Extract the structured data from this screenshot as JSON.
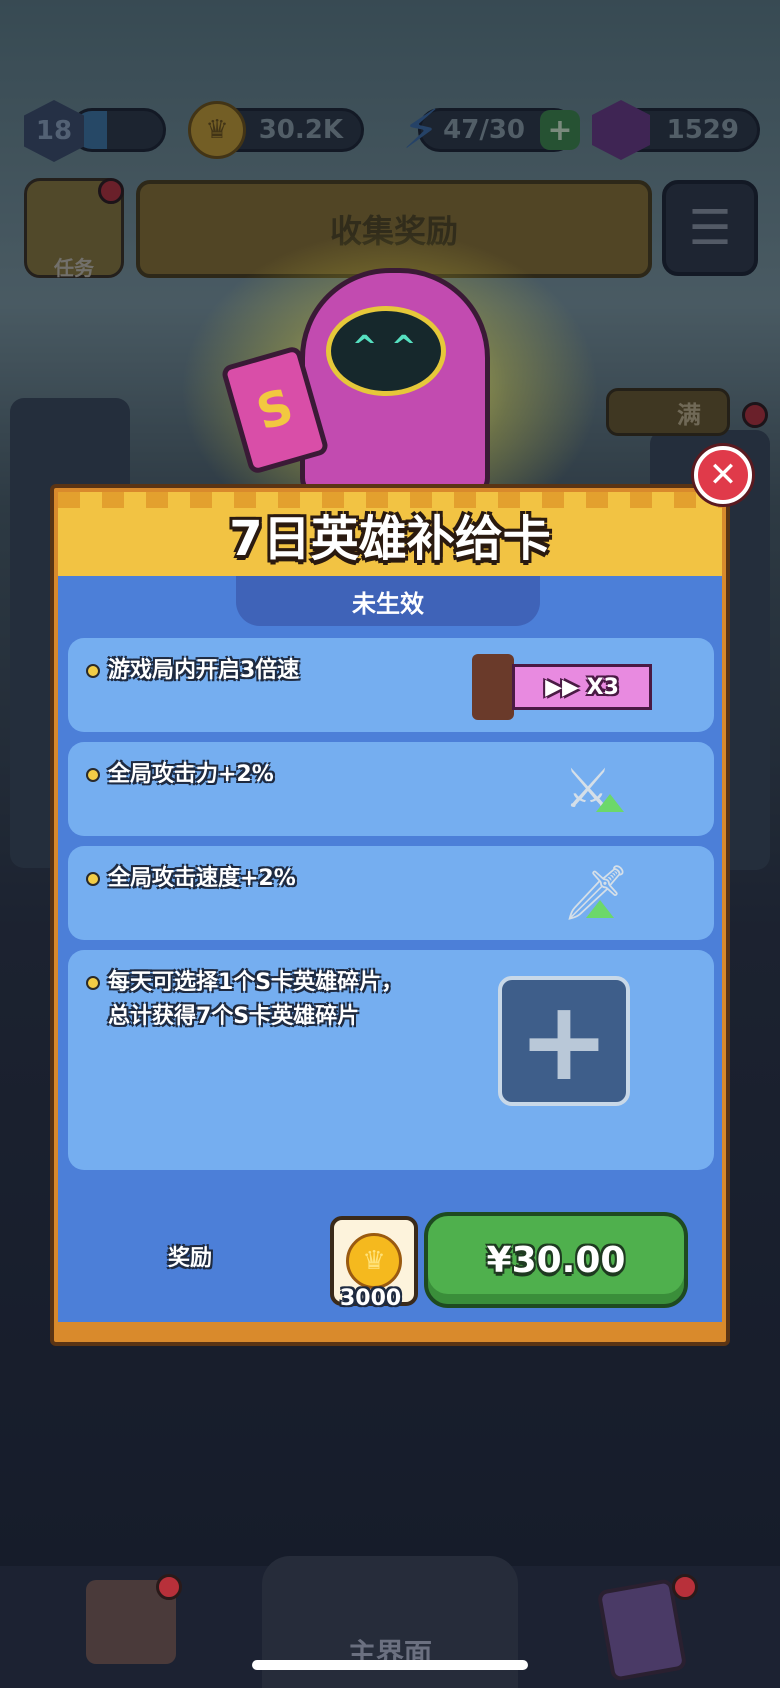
{
  "hud": {
    "level": "18",
    "xp_fraction": 0.38,
    "coins": "30.2K",
    "energy": "47/30",
    "gems": "1529"
  },
  "task_button": {
    "label": "任务"
  },
  "collect_bar": {
    "label": "收集奖励"
  },
  "full_tag": {
    "label": "满"
  },
  "modal": {
    "title": "7日英雄补给卡",
    "status": "未生效",
    "perks": [
      {
        "lines": [
          "游戏局内开启3倍速"
        ],
        "badge": "X3",
        "icon": "hourglass-speed-icon"
      },
      {
        "lines": [
          "全局攻击力+2%"
        ],
        "icon": "crossed-swords-icon"
      },
      {
        "lines": [
          "全局攻击速度+2%"
        ],
        "icon": "sword-icon"
      },
      {
        "lines": [
          "每天可选择1个S卡英雄碎片，",
          "总计获得7个S卡英雄碎片"
        ],
        "icon": "plus-icon"
      }
    ],
    "reward_label": "奖励",
    "reward_amount": "3000",
    "price": "¥30.00"
  },
  "bottom_nav": {
    "center_label": "主界面"
  },
  "colors": {
    "header_yellow": "#f2c343",
    "body_blue": "#4c7fd8",
    "perk_blue": "#75aef0",
    "buy_green": "#4fb04d",
    "close_red": "#e03a4a"
  }
}
